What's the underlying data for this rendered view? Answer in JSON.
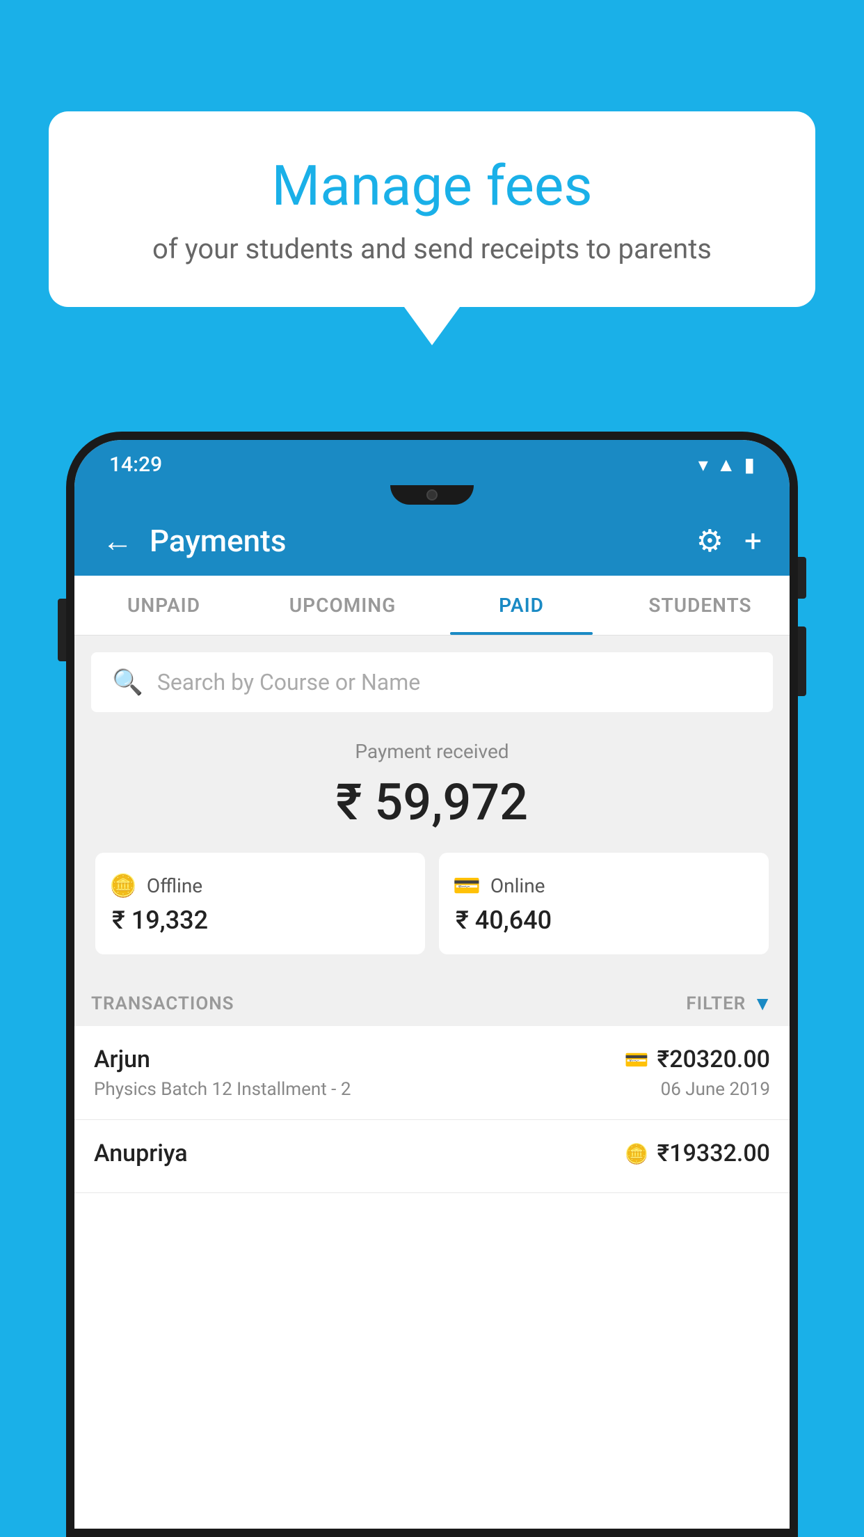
{
  "page": {
    "background_color": "#1ab0e8"
  },
  "speech_bubble": {
    "title": "Manage fees",
    "subtitle": "of your students and send receipts to parents"
  },
  "status_bar": {
    "time": "14:29",
    "icons": [
      "wifi",
      "signal",
      "battery"
    ]
  },
  "app_header": {
    "title": "Payments",
    "back_label": "←",
    "settings_label": "⚙",
    "add_label": "+"
  },
  "tabs": [
    {
      "label": "UNPAID",
      "active": false
    },
    {
      "label": "UPCOMING",
      "active": false
    },
    {
      "label": "PAID",
      "active": true
    },
    {
      "label": "STUDENTS",
      "active": false
    }
  ],
  "search": {
    "placeholder": "Search by Course or Name"
  },
  "payment_summary": {
    "label": "Payment received",
    "total_amount": "₹ 59,972",
    "offline": {
      "label": "Offline",
      "amount": "₹ 19,332"
    },
    "online": {
      "label": "Online",
      "amount": "₹ 40,640"
    }
  },
  "transactions_section": {
    "label": "TRANSACTIONS",
    "filter_label": "FILTER"
  },
  "transactions": [
    {
      "name": "Arjun",
      "course": "Physics Batch 12 Installment - 2",
      "amount": "₹20320.00",
      "date": "06 June 2019",
      "payment_type": "card"
    },
    {
      "name": "Anupriya",
      "course": "",
      "amount": "₹19332.00",
      "date": "",
      "payment_type": "cash"
    }
  ]
}
